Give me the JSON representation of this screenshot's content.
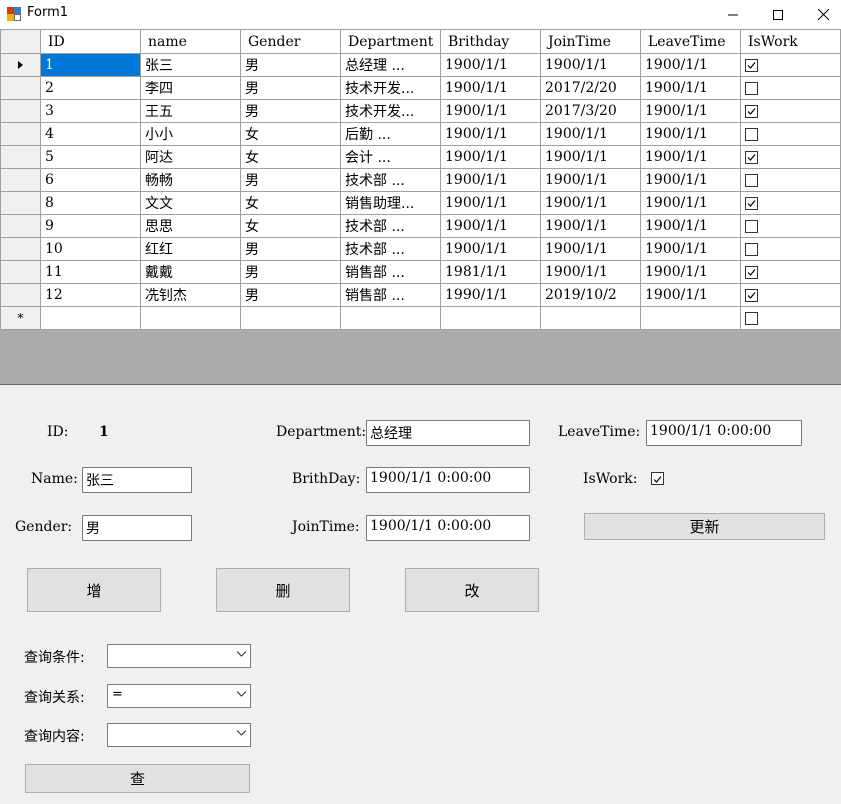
{
  "window": {
    "title": "Form1"
  },
  "grid": {
    "columns": [
      "ID",
      "name",
      "Gender",
      "Department",
      "Brithday",
      "JoinTime",
      "LeaveTime",
      "IsWork"
    ],
    "rows": [
      {
        "id": "1",
        "name": "张三",
        "gender": "男",
        "dept": "总经理   ...",
        "birthday": "1900/1/1",
        "join": "1900/1/1",
        "leave": "1900/1/1",
        "iswork": true
      },
      {
        "id": "2",
        "name": "李四",
        "gender": "男",
        "dept": "技术开发...",
        "birthday": "1900/1/1",
        "join": "2017/2/20",
        "leave": "1900/1/1",
        "iswork": false
      },
      {
        "id": "3",
        "name": "王五",
        "gender": "男",
        "dept": "技术开发...",
        "birthday": "1900/1/1",
        "join": "2017/3/20",
        "leave": "1900/1/1",
        "iswork": true
      },
      {
        "id": "4",
        "name": "小小",
        "gender": "女",
        "dept": "后勤     ...",
        "birthday": "1900/1/1",
        "join": "1900/1/1",
        "leave": "1900/1/1",
        "iswork": false
      },
      {
        "id": "5",
        "name": "阿达",
        "gender": "女",
        "dept": "会计     ...",
        "birthday": "1900/1/1",
        "join": "1900/1/1",
        "leave": "1900/1/1",
        "iswork": true
      },
      {
        "id": "6",
        "name": "畅畅",
        "gender": "男",
        "dept": "技术部   ...",
        "birthday": "1900/1/1",
        "join": "1900/1/1",
        "leave": "1900/1/1",
        "iswork": false
      },
      {
        "id": "8",
        "name": "文文",
        "gender": "女",
        "dept": "销售助理...",
        "birthday": "1900/1/1",
        "join": "1900/1/1",
        "leave": "1900/1/1",
        "iswork": true
      },
      {
        "id": "9",
        "name": "思思",
        "gender": "女",
        "dept": "技术部   ...",
        "birthday": "1900/1/1",
        "join": "1900/1/1",
        "leave": "1900/1/1",
        "iswork": false
      },
      {
        "id": "10",
        "name": "红红",
        "gender": "男",
        "dept": "技术部   ...",
        "birthday": "1900/1/1",
        "join": "1900/1/1",
        "leave": "1900/1/1",
        "iswork": false
      },
      {
        "id": "11",
        "name": "戴戴",
        "gender": "男",
        "dept": "销售部   ...",
        "birthday": "1981/1/1",
        "join": "1900/1/1",
        "leave": "1900/1/1",
        "iswork": true
      },
      {
        "id": "12",
        "name": "冼钊杰",
        "gender": "男",
        "dept": "销售部   ...",
        "birthday": "1990/1/1",
        "join": "2019/10/2",
        "leave": "1900/1/1",
        "iswork": true
      }
    ],
    "new_row_marker": "*",
    "selected_color": "#0078d7"
  },
  "form": {
    "id_label": "ID:",
    "id_value": "1",
    "name_label": "Name:",
    "name_value": "张三",
    "gender_label": "Gender:",
    "gender_value": "男",
    "department_label": "Department:",
    "department_value": "总经理",
    "birthday_label": "BrithDay:",
    "birthday_value": "1900/1/1 0:00:00",
    "jointime_label": "JoinTime:",
    "jointime_value": "1900/1/1 0:00:00",
    "leavetime_label": "LeaveTime:",
    "leavetime_value": "1900/1/1 0:00:00",
    "iswork_label": "IsWork:",
    "iswork_checked": true,
    "update_button": "更新",
    "add_button": "增",
    "delete_button": "删",
    "modify_button": "改"
  },
  "query": {
    "condition_label": "查询条件:",
    "condition_value": "",
    "relation_label": "查询关系:",
    "relation_value": "=",
    "content_label": "查询内容:",
    "content_value": "",
    "search_button": "查"
  }
}
